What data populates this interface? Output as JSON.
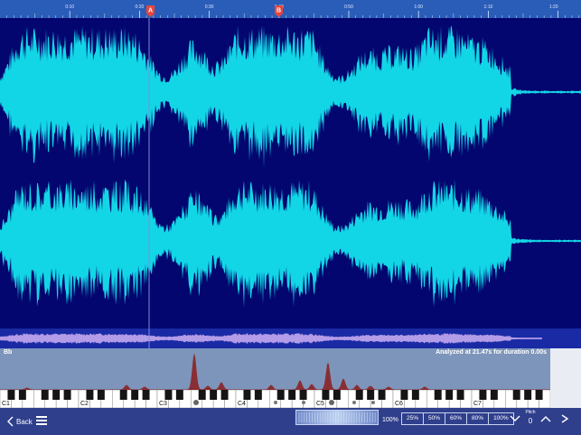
{
  "ruler": {
    "ticks": [
      "0:10",
      "0:20",
      "0:30",
      "0:40",
      "0:50",
      "1:00",
      "1:10",
      "1:20"
    ],
    "marker_a": "A",
    "marker_b": "B"
  },
  "spectrum": {
    "note": "Bb",
    "analysis": "Analyzed at 21.47s for duration 0.00s"
  },
  "keyboard": {
    "labels": [
      "C1",
      "C2",
      "C3",
      "C4",
      "C5",
      "C6",
      "C7"
    ]
  },
  "toolbar": {
    "back_label": "Back",
    "zoom_percent": "100%",
    "zoom_options": [
      "25%",
      "50%",
      "60%",
      "80%",
      "100%"
    ],
    "pitch_label": "Pitch",
    "pitch_value": "0"
  },
  "colors": {
    "waveform": "#12d6e6",
    "overview_wave": "#b39ce8",
    "ruler_bg": "#2a5db8",
    "marker": "#e8453c",
    "spectrum_peak": "#8a1c1c"
  }
}
